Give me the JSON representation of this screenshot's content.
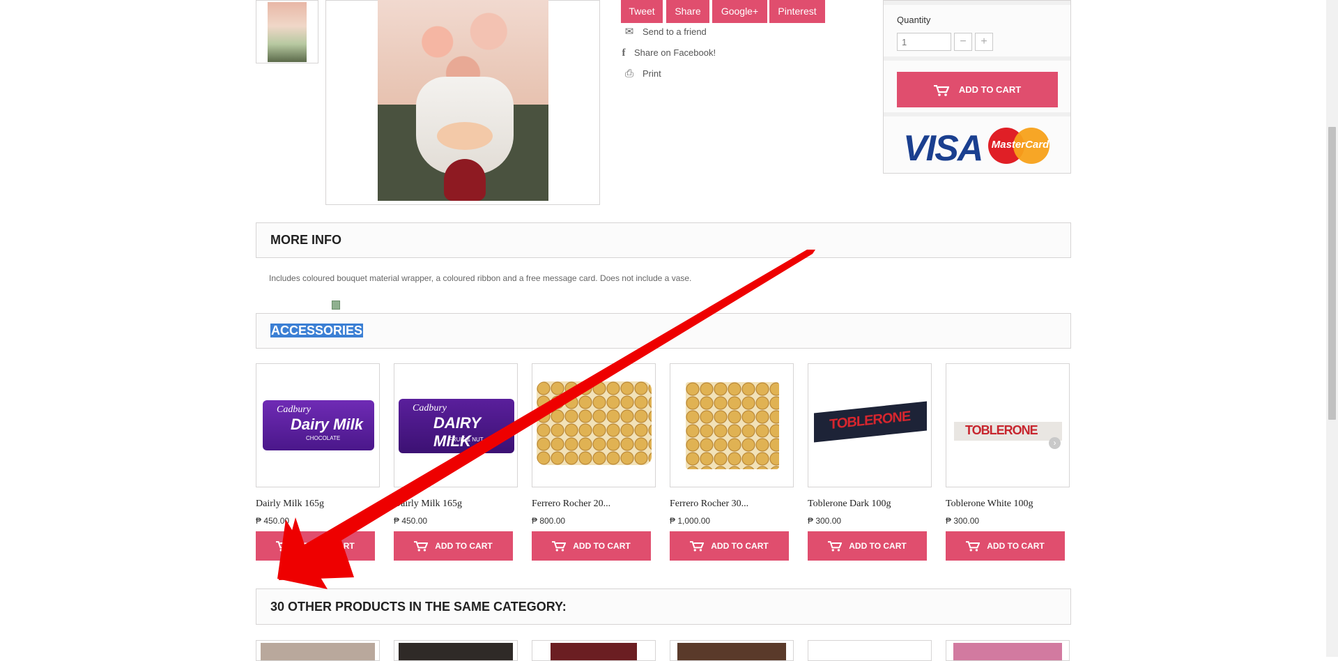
{
  "social": {
    "tweet": "Tweet",
    "share": "Share",
    "google": "Google+",
    "pinterest": "Pinterest",
    "send_to_friend": "Send to a friend",
    "share_facebook": "Share on Facebook!",
    "print": "Print"
  },
  "buy_box": {
    "quantity_label": "Quantity",
    "quantity_value": "1",
    "minus": "−",
    "plus": "+",
    "add_to_cart": "ADD TO CART",
    "visa_text": "VISA",
    "mastercard_text": "MasterCard"
  },
  "more_info": {
    "title": "MORE INFO",
    "text": "Includes coloured bouquet material wrapper, a coloured ribbon and a free message card. Does not include a vase."
  },
  "accessories": {
    "title": "ACCESSORIES",
    "products": [
      {
        "name": "Dairly Milk 165g",
        "price": "₱ 450.00",
        "button": "ADD TO CART",
        "art_brand": "Cadbury",
        "art_label": "Dairy Milk",
        "art_sub": "CHOCOLATE"
      },
      {
        "name": "Dairly Milk 165g",
        "price": "₱ 450.00",
        "button": "ADD TO CART",
        "art_brand": "Cadbury",
        "art_label": "DAIRY MILK",
        "art_sub": "FRUIT & NUT"
      },
      {
        "name": "Ferrero Rocher 20...",
        "price": "₱ 800.00",
        "button": "ADD TO CART"
      },
      {
        "name": "Ferrero Rocher 30...",
        "price": "₱ 1,000.00",
        "button": "ADD TO CART"
      },
      {
        "name": "Toblerone Dark 100g",
        "price": "₱ 300.00",
        "button": "ADD TO CART",
        "art_label": "TOBLERONE"
      },
      {
        "name": "Toblerone White 100g",
        "price": "₱ 300.00",
        "button": "ADD TO CART",
        "art_label": "TOBLERONE"
      }
    ]
  },
  "other_products": {
    "title": "30 OTHER PRODUCTS IN THE SAME CATEGORY:"
  },
  "colors": {
    "accent": "#e04e6e",
    "annotation_arrow": "#ee0000",
    "selection": "#3b7fd4"
  }
}
